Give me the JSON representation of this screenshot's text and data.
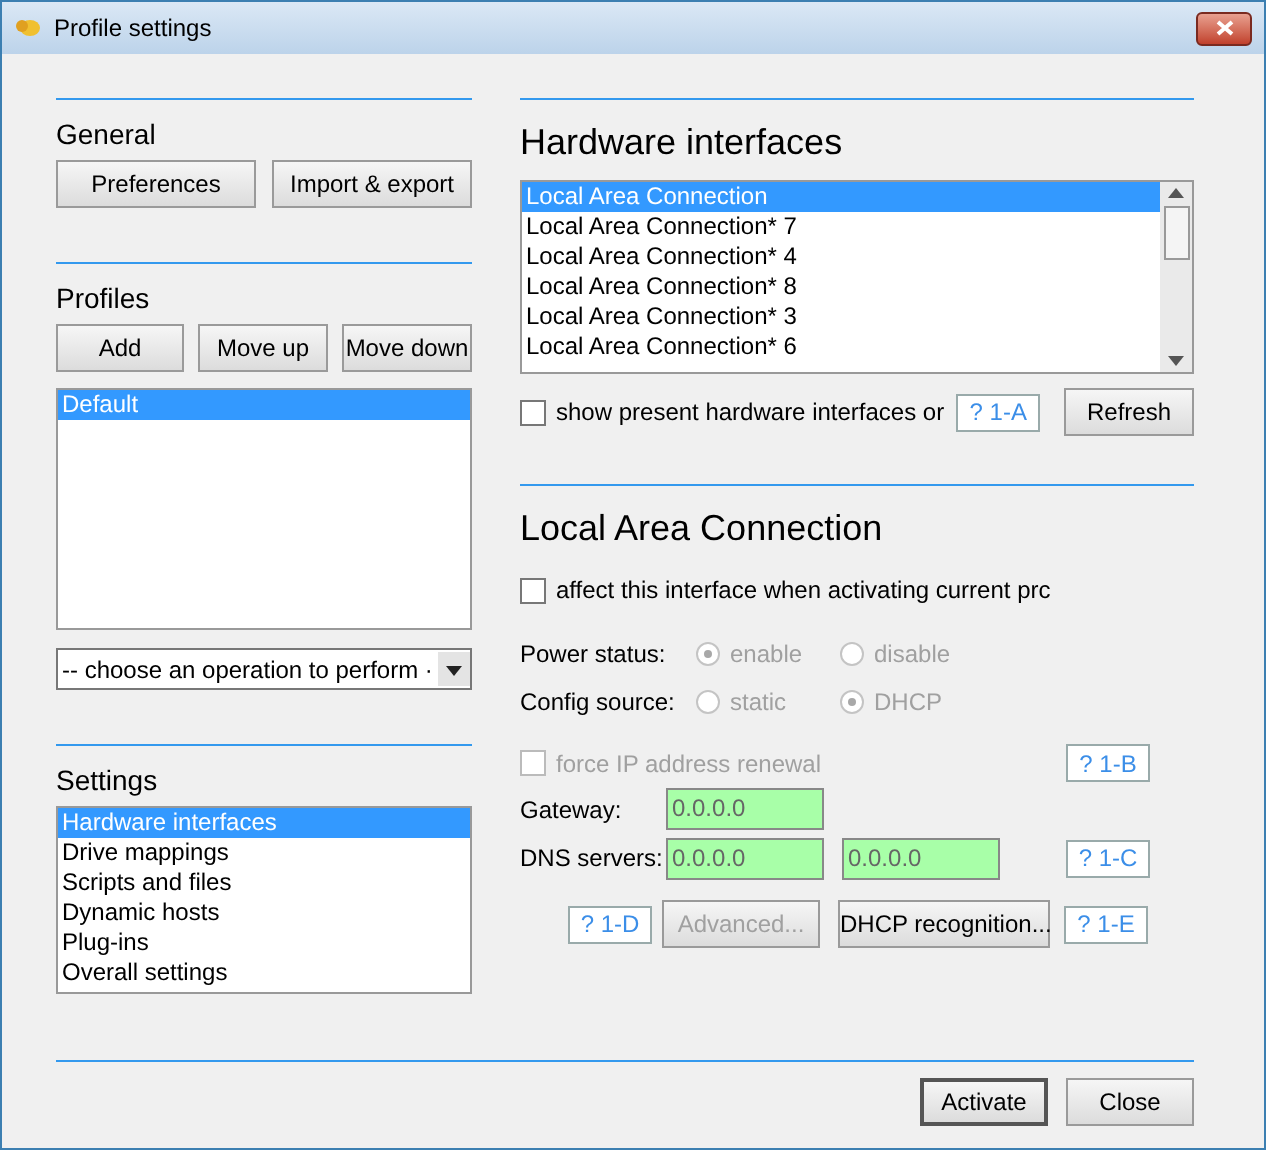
{
  "window": {
    "title": "Profile settings"
  },
  "general": {
    "title": "General",
    "buttons": [
      "Preferences",
      "Import & export"
    ]
  },
  "profiles": {
    "title": "Profiles",
    "buttons": [
      "Add",
      "Move up",
      "Move down"
    ],
    "items": [
      {
        "label": "Default",
        "selected": true
      }
    ],
    "operation_select": {
      "value": "-- choose an operation to perform ·"
    }
  },
  "settings": {
    "title": "Settings",
    "items": [
      {
        "label": "Hardware interfaces",
        "selected": true
      },
      {
        "label": "Drive mappings",
        "selected": false
      },
      {
        "label": "Scripts and files",
        "selected": false
      },
      {
        "label": "Dynamic hosts",
        "selected": false
      },
      {
        "label": "Plug-ins",
        "selected": false
      },
      {
        "label": "Overall settings",
        "selected": false
      }
    ]
  },
  "hardware": {
    "title": "Hardware interfaces",
    "items": [
      {
        "label": "Local Area Connection",
        "selected": true
      },
      {
        "label": "Local Area Connection* 7",
        "selected": false
      },
      {
        "label": "Local Area Connection* 4",
        "selected": false
      },
      {
        "label": "Local Area Connection* 8",
        "selected": false
      },
      {
        "label": "Local Area Connection* 3",
        "selected": false
      },
      {
        "label": "Local Area Connection* 6",
        "selected": false
      }
    ],
    "show_present": {
      "label": "show present hardware interfaces or",
      "checked": false
    },
    "help": "? 1-A",
    "refresh": "Refresh"
  },
  "connection": {
    "title": "Local Area Connection",
    "affect": {
      "label": "affect this interface when activating current prc",
      "checked": false
    },
    "radio_groups": [
      {
        "label": "Power status:",
        "disabled": true,
        "options": [
          {
            "label": "enable",
            "selected": true
          },
          {
            "label": "disable",
            "selected": false
          }
        ]
      },
      {
        "label": "Config source:",
        "disabled": true,
        "options": [
          {
            "label": "static",
            "selected": false
          },
          {
            "label": "DHCP",
            "selected": true
          }
        ]
      }
    ],
    "force_renewal": {
      "label": "force IP address renewal",
      "checked": false,
      "disabled": true
    },
    "help_b": "? 1-B",
    "gateway": {
      "label": "Gateway:",
      "value": "0.0.0.0"
    },
    "dns": {
      "label": "DNS servers:",
      "values": [
        "0.0.0.0",
        "0.0.0.0"
      ]
    },
    "help_c": "? 1-C",
    "help_d": "? 1-D",
    "advanced": {
      "label": "Advanced...",
      "disabled": true
    },
    "dhcp_recognition": {
      "label": "DHCP recognition...",
      "disabled": false
    },
    "help_e": "? 1-E"
  },
  "footer": {
    "buttons": [
      {
        "label": "Activate",
        "default": true
      },
      {
        "label": "Close",
        "default": false
      }
    ]
  }
}
